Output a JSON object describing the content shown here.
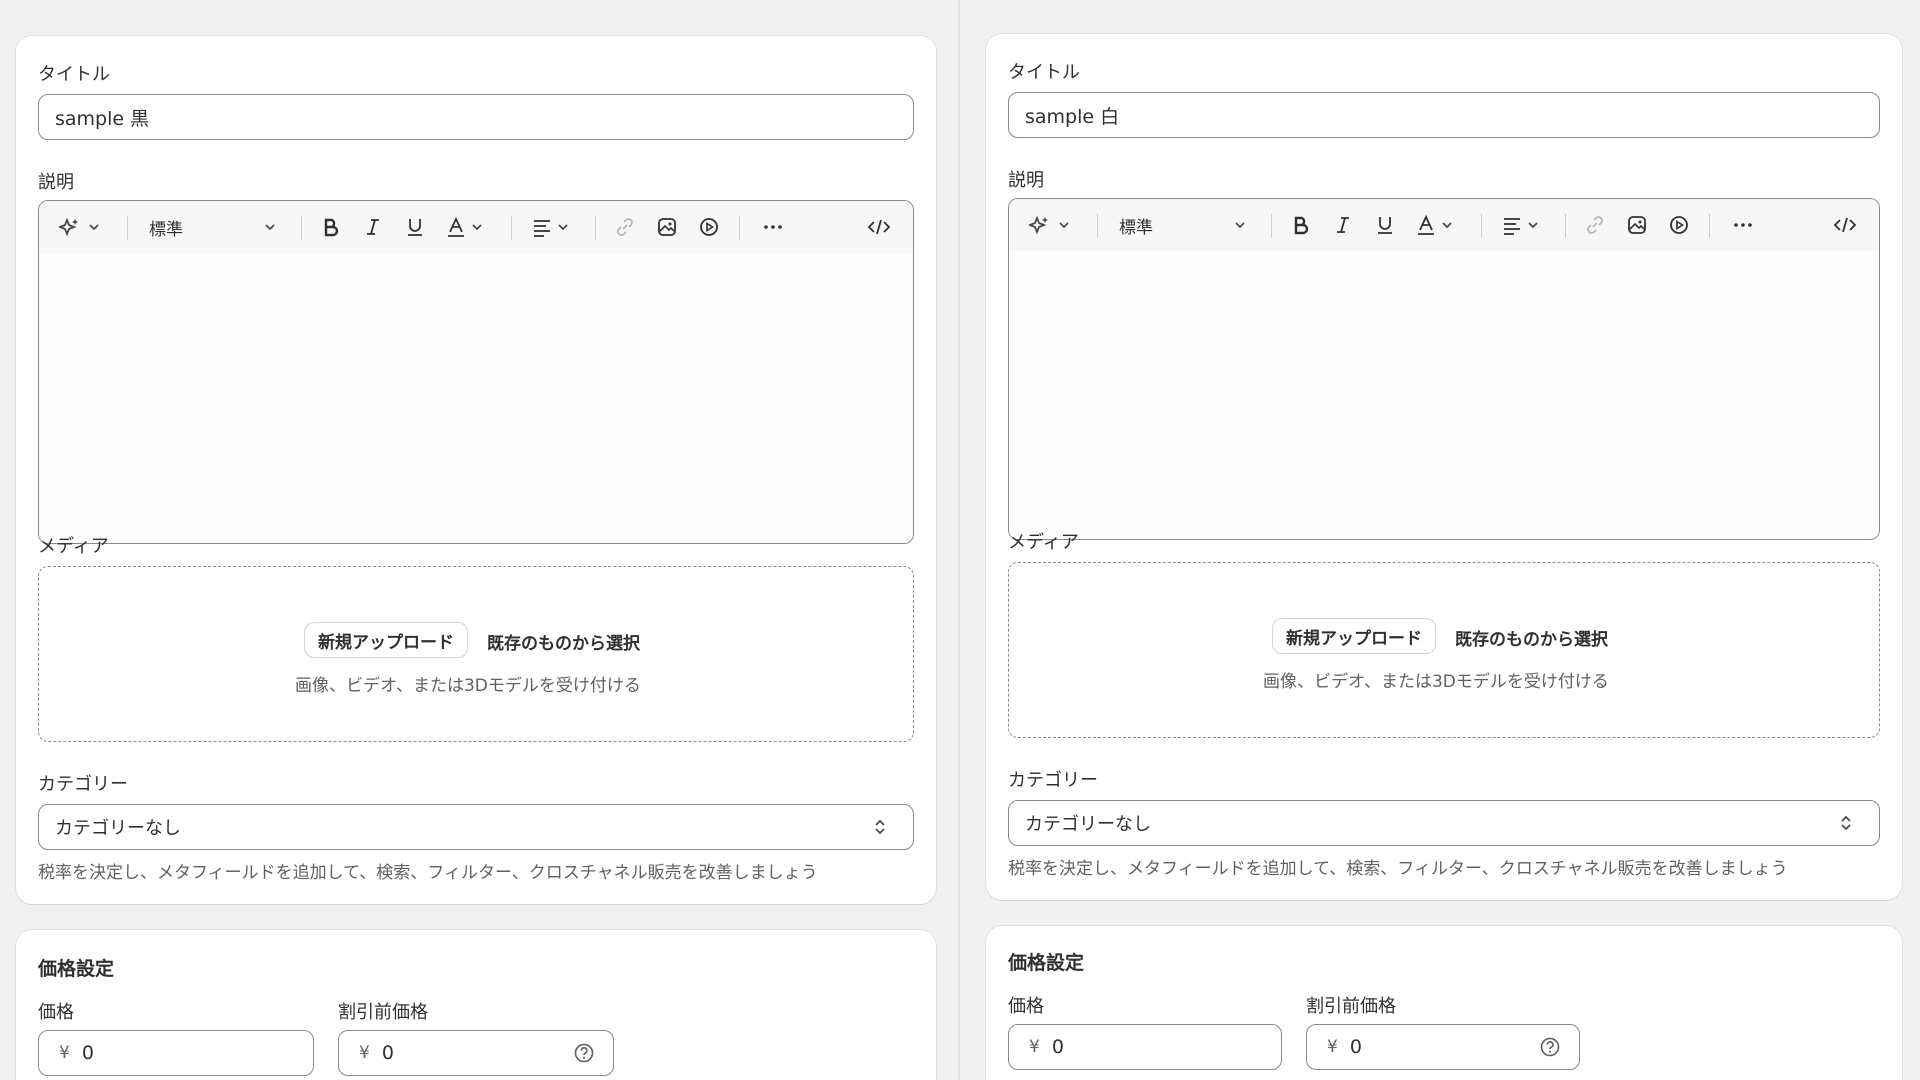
{
  "products": [
    {
      "title_label": "タイトル",
      "title_value": "sample 黒",
      "description_label": "説明",
      "toolbar": {
        "format_label": "標準"
      },
      "media_label": "メディア",
      "media_upload_label": "新規アップロード",
      "media_select_label": "既存のものから選択",
      "media_hint": "画像、ビデオ、または3Dモデルを受け付ける",
      "category_label": "カテゴリー",
      "category_value": "カテゴリーなし",
      "category_help": "税率を決定し、メタフィールドを追加して、検索、フィルター、クロスチャネル販売を改善しましょう",
      "pricing_heading": "価格設定",
      "price_label": "価格",
      "price_currency": "¥",
      "price_value": "0",
      "compare_price_label": "割引前価格",
      "compare_price_currency": "¥",
      "compare_price_value": "0"
    },
    {
      "title_label": "タイトル",
      "title_value": "sample 白",
      "description_label": "説明",
      "toolbar": {
        "format_label": "標準"
      },
      "media_label": "メディア",
      "media_upload_label": "新規アップロード",
      "media_select_label": "既存のものから選択",
      "media_hint": "画像、ビデオ、または3Dモデルを受け付ける",
      "category_label": "カテゴリー",
      "category_value": "カテゴリーなし",
      "category_help": "税率を決定し、メタフィールドを追加して、検索、フィルター、クロスチャネル販売を改善しましょう",
      "pricing_heading": "価格設定",
      "price_label": "価格",
      "price_currency": "¥",
      "price_value": "0",
      "compare_price_label": "割引前価格",
      "compare_price_currency": "¥",
      "compare_price_value": "0"
    }
  ],
  "icons": {
    "magic": "sparkle-icon",
    "chevron": "chevron-down-icon",
    "bold": "bold-icon",
    "italic": "italic-icon",
    "underline": "underline-icon",
    "text_color": "text-color-icon",
    "align": "align-left-icon",
    "link": "link-icon",
    "image": "image-icon",
    "video": "video-icon",
    "more": "more-icon",
    "code": "code-icon",
    "select": "select-chevrons-icon",
    "help": "question-circle-icon"
  }
}
